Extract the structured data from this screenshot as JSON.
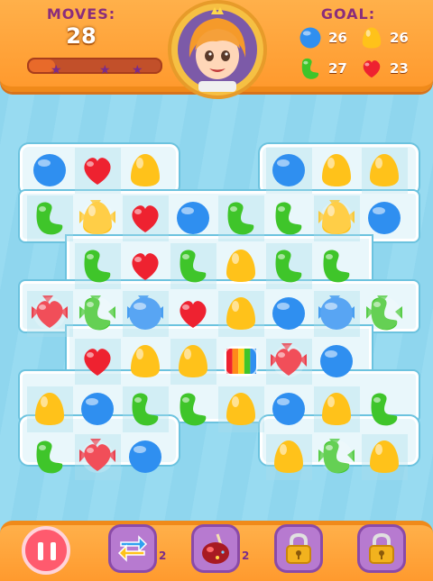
{
  "hud": {
    "moves_label": "MOVES:",
    "moves_value": "28",
    "moves_progress": 0.2,
    "stars": 3,
    "goal_label": "GOAL:",
    "goals": [
      {
        "candy": "blue",
        "count": "26"
      },
      {
        "candy": "yellow",
        "count": "26"
      },
      {
        "candy": "green",
        "count": "27"
      },
      {
        "candy": "red",
        "count": "23"
      }
    ]
  },
  "colors": {
    "blue": "#2f8ff0",
    "yellow": "#ffc21a",
    "green": "#3fc52a",
    "red": "#ee2230",
    "topbar": "#ffa83c",
    "purple": "#8a2d7c"
  },
  "board": {
    "cols": 9,
    "rows": 7,
    "grid": [
      [
        "blue",
        "red",
        "yellow",
        null,
        null,
        "blue",
        "yellow",
        "yellow",
        null
      ],
      [
        "green",
        "wrapped-yellow",
        "red",
        "blue",
        "green",
        "green",
        "wrapped-yellow",
        "blue",
        null
      ],
      [
        null,
        "green",
        "red",
        "green",
        "yellow",
        "green",
        "green",
        null,
        null
      ],
      [
        "wrapped-red",
        "wrapped-green",
        "wrapped-blue",
        "red",
        "yellow",
        "blue",
        "wrapped-blue",
        "wrapped-green",
        null
      ],
      [
        null,
        "red",
        "yellow",
        "yellow",
        "rainbow",
        "wrapped-red",
        "blue",
        null,
        null
      ],
      [
        "yellow",
        "blue",
        "green",
        "green",
        "yellow",
        "blue",
        "yellow",
        "green",
        null
      ],
      [
        "green",
        "wrapped-red",
        "blue",
        null,
        null,
        "yellow",
        "wrapped-green",
        "yellow",
        null
      ]
    ]
  },
  "boosters": [
    {
      "name": "shuffle",
      "count": "2",
      "locked": false
    },
    {
      "name": "candy-apple",
      "count": "2",
      "locked": false
    },
    {
      "name": "locked-1",
      "count": "",
      "locked": true
    },
    {
      "name": "locked-2",
      "count": "",
      "locked": true
    }
  ]
}
